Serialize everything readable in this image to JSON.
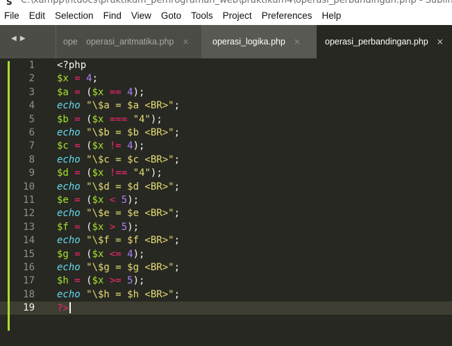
{
  "window": {
    "title": "C:\\xampp\\htdocs\\praktikum_pemrograman_web\\praktikum4\\operasi_perbandingan.php - Sublim"
  },
  "menubar": {
    "items": [
      "File",
      "Edit",
      "Selection",
      "Find",
      "View",
      "Goto",
      "Tools",
      "Project",
      "Preferences",
      "Help"
    ]
  },
  "tabbar": {
    "nav_arrows": "◀ ▶",
    "tabs": [
      {
        "label": "opera",
        "close": ""
      },
      {
        "label": "operasi_aritmatika.php",
        "close": "×"
      },
      {
        "label": "operasi_logika.php",
        "close": "×"
      },
      {
        "label": "operasi_perbandingan.php",
        "close": "×"
      }
    ],
    "active_tab_index": 3
  },
  "editor": {
    "active_line": 19,
    "lines": [
      {
        "n": "1",
        "tokens": [
          {
            "t": "<?php",
            "c": "p"
          }
        ]
      },
      {
        "n": "2",
        "tokens": [
          {
            "t": "$x",
            "c": "v"
          },
          {
            "t": " = ",
            "c": "o"
          },
          {
            "t": "4",
            "c": "n"
          },
          {
            "t": ";",
            "c": "p"
          }
        ]
      },
      {
        "n": "3",
        "tokens": [
          {
            "t": "$a",
            "c": "v"
          },
          {
            "t": " = ",
            "c": "o"
          },
          {
            "t": "(",
            "c": "p"
          },
          {
            "t": "$x",
            "c": "v"
          },
          {
            "t": " == ",
            "c": "o"
          },
          {
            "t": "4",
            "c": "n"
          },
          {
            "t": ");",
            "c": "p"
          }
        ]
      },
      {
        "n": "4",
        "tokens": [
          {
            "t": "echo",
            "c": "k"
          },
          {
            "t": " \"\\$a = $a <BR>\"",
            "c": "s"
          },
          {
            "t": ";",
            "c": "p"
          }
        ]
      },
      {
        "n": "5",
        "tokens": [
          {
            "t": "$b",
            "c": "v"
          },
          {
            "t": " = ",
            "c": "o"
          },
          {
            "t": "(",
            "c": "p"
          },
          {
            "t": "$x",
            "c": "v"
          },
          {
            "t": " === ",
            "c": "o"
          },
          {
            "t": "\"4\"",
            "c": "s"
          },
          {
            "t": ");",
            "c": "p"
          }
        ]
      },
      {
        "n": "6",
        "tokens": [
          {
            "t": "echo",
            "c": "k"
          },
          {
            "t": " \"\\$b = $b <BR>\"",
            "c": "s"
          },
          {
            "t": ";",
            "c": "p"
          }
        ]
      },
      {
        "n": "7",
        "tokens": [
          {
            "t": "$c",
            "c": "v"
          },
          {
            "t": " = ",
            "c": "o"
          },
          {
            "t": "(",
            "c": "p"
          },
          {
            "t": "$x",
            "c": "v"
          },
          {
            "t": " != ",
            "c": "o"
          },
          {
            "t": "4",
            "c": "n"
          },
          {
            "t": ");",
            "c": "p"
          }
        ]
      },
      {
        "n": "8",
        "tokens": [
          {
            "t": "echo",
            "c": "k"
          },
          {
            "t": " \"\\$c = $c <BR>\"",
            "c": "s"
          },
          {
            "t": ";",
            "c": "p"
          }
        ]
      },
      {
        "n": "9",
        "tokens": [
          {
            "t": "$d",
            "c": "v"
          },
          {
            "t": " = ",
            "c": "o"
          },
          {
            "t": "(",
            "c": "p"
          },
          {
            "t": "$x",
            "c": "v"
          },
          {
            "t": " !== ",
            "c": "o"
          },
          {
            "t": "\"4\"",
            "c": "s"
          },
          {
            "t": ");",
            "c": "p"
          }
        ]
      },
      {
        "n": "10",
        "tokens": [
          {
            "t": "echo",
            "c": "k"
          },
          {
            "t": " \"\\$d = $d <BR>\"",
            "c": "s"
          },
          {
            "t": ";",
            "c": "p"
          }
        ]
      },
      {
        "n": "11",
        "tokens": [
          {
            "t": "$e",
            "c": "v"
          },
          {
            "t": " = ",
            "c": "o"
          },
          {
            "t": "(",
            "c": "p"
          },
          {
            "t": "$x",
            "c": "v"
          },
          {
            "t": " < ",
            "c": "o"
          },
          {
            "t": "5",
            "c": "n"
          },
          {
            "t": ");",
            "c": "p"
          }
        ]
      },
      {
        "n": "12",
        "tokens": [
          {
            "t": "echo",
            "c": "k"
          },
          {
            "t": " \"\\$e = $e <BR>\"",
            "c": "s"
          },
          {
            "t": ";",
            "c": "p"
          }
        ]
      },
      {
        "n": "13",
        "tokens": [
          {
            "t": "$f",
            "c": "v"
          },
          {
            "t": " = ",
            "c": "o"
          },
          {
            "t": "(",
            "c": "p"
          },
          {
            "t": "$x",
            "c": "v"
          },
          {
            "t": " > ",
            "c": "o"
          },
          {
            "t": "5",
            "c": "n"
          },
          {
            "t": ");",
            "c": "p"
          }
        ]
      },
      {
        "n": "14",
        "tokens": [
          {
            "t": "echo",
            "c": "k"
          },
          {
            "t": " \"\\$f = $f <BR>\"",
            "c": "s"
          },
          {
            "t": ";",
            "c": "p"
          }
        ]
      },
      {
        "n": "15",
        "tokens": [
          {
            "t": "$g",
            "c": "v"
          },
          {
            "t": " = ",
            "c": "o"
          },
          {
            "t": "(",
            "c": "p"
          },
          {
            "t": "$x",
            "c": "v"
          },
          {
            "t": " <= ",
            "c": "o"
          },
          {
            "t": "4",
            "c": "n"
          },
          {
            "t": ");",
            "c": "p"
          }
        ]
      },
      {
        "n": "16",
        "tokens": [
          {
            "t": "echo",
            "c": "k"
          },
          {
            "t": " \"\\$g = $g <BR>\"",
            "c": "s"
          },
          {
            "t": ";",
            "c": "p"
          }
        ]
      },
      {
        "n": "17",
        "tokens": [
          {
            "t": "$h",
            "c": "v"
          },
          {
            "t": " = ",
            "c": "o"
          },
          {
            "t": "(",
            "c": "p"
          },
          {
            "t": "$x",
            "c": "v"
          },
          {
            "t": " >= ",
            "c": "o"
          },
          {
            "t": "5",
            "c": "n"
          },
          {
            "t": ");",
            "c": "p"
          }
        ]
      },
      {
        "n": "18",
        "tokens": [
          {
            "t": "echo",
            "c": "k"
          },
          {
            "t": " \"\\$h = $h <BR>\"",
            "c": "s"
          },
          {
            "t": ";",
            "c": "p"
          }
        ]
      },
      {
        "n": "19",
        "tokens": [
          {
            "t": "?>",
            "c": "o"
          }
        ]
      }
    ]
  },
  "colors": {
    "editor_bg": "#272822",
    "tabbar_bg": "#4b4c46",
    "gutter_mark": "#a6e22e",
    "variable": "#a6e22e",
    "operator": "#f92672",
    "number": "#ae81ff",
    "string": "#e6db74",
    "keyword": "#66d9ef"
  }
}
